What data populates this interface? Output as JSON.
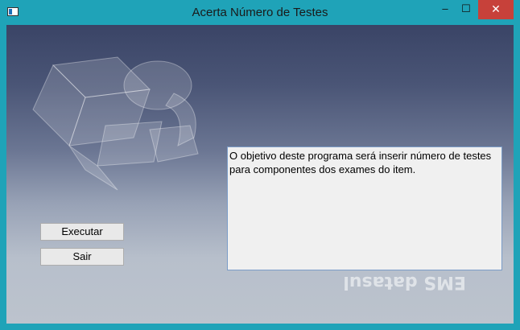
{
  "window": {
    "title": "Acerta Número de Testes",
    "controls": {
      "minimize": "–",
      "maximize": "☐",
      "close": "✕"
    }
  },
  "buttons": {
    "execute": "Executar",
    "exit": "Sair"
  },
  "description": {
    "text": "O objetivo deste programa será inserir número de testes\npara componentes dos exames do item."
  },
  "logo": {
    "icon": "ems-logo-icon"
  },
  "watermark": {
    "text": "EMS Datasul",
    "icon": "ems-reflection-icon"
  },
  "colors": {
    "frame": "#1fa3b8",
    "close": "#c7413a",
    "memo_border": "#7a9cc8"
  }
}
